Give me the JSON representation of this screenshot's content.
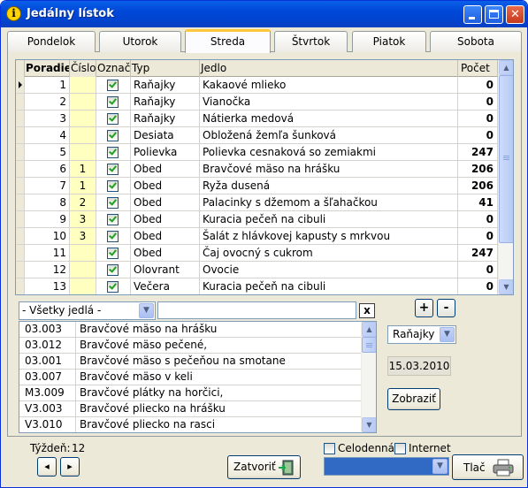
{
  "window": {
    "title": "Jedálny lístok",
    "icon_glyph": "i"
  },
  "tabs": [
    {
      "label": "Pondelok",
      "active": false
    },
    {
      "label": "Utorok",
      "active": false
    },
    {
      "label": "Streda",
      "active": true
    },
    {
      "label": "Štvrtok",
      "active": false
    },
    {
      "label": "Piatok",
      "active": false
    },
    {
      "label": "Sobota",
      "active": false
    }
  ],
  "grid": {
    "columns": {
      "poradie": "Poradie",
      "cislo": "Číslo",
      "oznac": "Označ",
      "typ": "Typ",
      "jedlo": "Jedlo",
      "pocet": "Počet"
    },
    "rows": [
      {
        "poradie": "1",
        "cislo": "",
        "checked": true,
        "typ": "Raňajky",
        "jedlo": "Kakaové mlieko",
        "pocet": "0",
        "current": true
      },
      {
        "poradie": "2",
        "cislo": "",
        "checked": true,
        "typ": "Raňajky",
        "jedlo": "Vianočka",
        "pocet": "0"
      },
      {
        "poradie": "3",
        "cislo": "",
        "checked": true,
        "typ": "Raňajky",
        "jedlo": "Nátierka medová",
        "pocet": "0"
      },
      {
        "poradie": "4",
        "cislo": "",
        "checked": true,
        "typ": "Desiata",
        "jedlo": "Obložená žemľa šunková",
        "pocet": "0"
      },
      {
        "poradie": "5",
        "cislo": "",
        "checked": true,
        "typ": "Polievka",
        "jedlo": "Polievka cesnaková so zemiakmi",
        "pocet": "247"
      },
      {
        "poradie": "6",
        "cislo": "1",
        "checked": true,
        "typ": "Obed",
        "jedlo": "Bravčové mäso na hrášku",
        "pocet": "206"
      },
      {
        "poradie": "7",
        "cislo": "1",
        "checked": true,
        "typ": "Obed",
        "jedlo": "Ryža dusená",
        "pocet": "206"
      },
      {
        "poradie": "8",
        "cislo": "2",
        "checked": true,
        "typ": "Obed",
        "jedlo": "Palacinky s džemom a šľahačkou",
        "pocet": "41"
      },
      {
        "poradie": "9",
        "cislo": "3",
        "checked": true,
        "typ": "Obed",
        "jedlo": "Kuracia pečeň na cibuli",
        "pocet": "0"
      },
      {
        "poradie": "10",
        "cislo": "3",
        "checked": true,
        "typ": "Obed",
        "jedlo": "Šalát z hlávkovej kapusty s mrkvou",
        "pocet": "0"
      },
      {
        "poradie": "11",
        "cislo": "",
        "checked": true,
        "typ": "Obed",
        "jedlo": "Čaj ovocný s cukrom",
        "pocet": "247"
      },
      {
        "poradie": "12",
        "cislo": "",
        "checked": true,
        "typ": "Olovrant",
        "jedlo": "Ovocie",
        "pocet": "0"
      },
      {
        "poradie": "13",
        "cislo": "",
        "checked": true,
        "typ": "Večera",
        "jedlo": "Kuracia pečeň na cibuli",
        "pocet": "0"
      }
    ]
  },
  "filter": {
    "category_value": "- Všetky jedlá -",
    "search_value": "",
    "clear_label": "x"
  },
  "meal_list": [
    {
      "code": "03.003",
      "name": "Bravčové mäso na hrášku"
    },
    {
      "code": "03.012",
      "name": "Bravčové mäso pečené,"
    },
    {
      "code": "03.001",
      "name": "Bravčové mäso s pečeňou na smotane"
    },
    {
      "code": "03.007",
      "name": "Bravčové mäso v keli"
    },
    {
      "code": "M3.009",
      "name": "Bravčové plátky na horčici,"
    },
    {
      "code": "V3.003",
      "name": "Bravčové pliecko na hrášku"
    },
    {
      "code": "V3.010",
      "name": "Bravčové pliecko na rasci"
    }
  ],
  "side": {
    "add_label": "+",
    "remove_label": "-",
    "type_value": "Raňajky",
    "date": "15.03.2010",
    "show_label": "Zobraziť"
  },
  "footer": {
    "week_label": "Týždeň:",
    "week_value": "12",
    "prev_label": "◂",
    "next_label": "▸",
    "close_label": "Zatvoriť",
    "whole_day_label": "Celodenná",
    "internet_label": "Internet",
    "print_label": "Tlač"
  },
  "colors": {
    "titlebar": "#0048d8",
    "active_tab_accent": "#ffc83c",
    "number_column_bg": "#ffffc0",
    "printer_combo": "#316ac5"
  }
}
